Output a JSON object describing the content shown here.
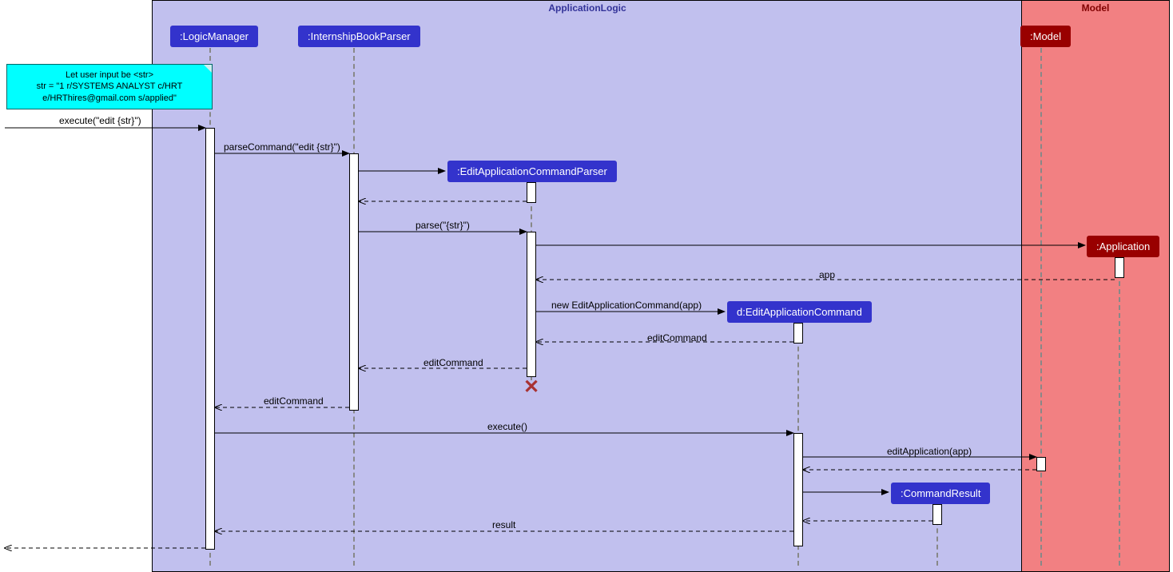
{
  "regions": {
    "appLogic": "ApplicationLogic",
    "model": "Model"
  },
  "participants": {
    "logicManager": ":LogicManager",
    "internshipBookParser": ":InternshipBookParser",
    "editAppCmdParser": ":EditApplicationCommandParser",
    "editAppCmd": "d:EditApplicationCommand",
    "commandResult": ":CommandResult",
    "modelP": ":Model",
    "application": ":Application"
  },
  "note": {
    "line1": "Let user input be <str>",
    "line2": "str = \"1 r/SYSTEMS ANALYST c/HRT",
    "line3": "e/HRThires@gmail.com s/applied\""
  },
  "messages": {
    "executeEdit": "execute(\"edit {str}\")",
    "parseCommand": "parseCommand(\"edit {str}\")",
    "parseStr": "parse(\"{str}\")",
    "app": "app",
    "newEditCmd": "new EditApplicationCommand(app)",
    "editCommandRet1": "editCommand",
    "editCommandRet2": "editCommand",
    "editCommandRet3": "editCommand",
    "execute": "execute()",
    "editApplication": "editApplication(app)",
    "result": "result"
  }
}
